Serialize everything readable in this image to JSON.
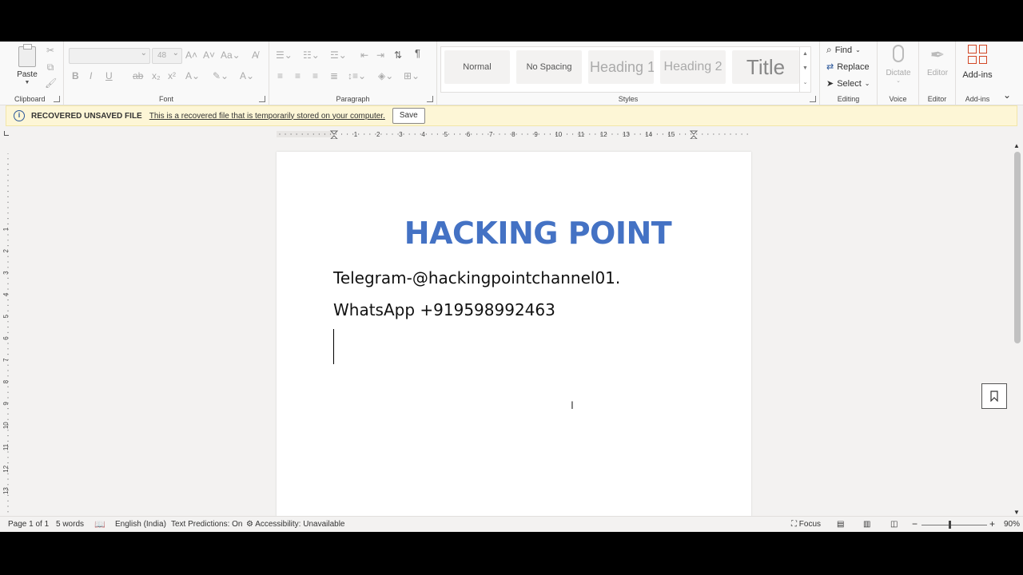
{
  "ribbon": {
    "clipboard": {
      "paste_label": "Paste",
      "group_label": "Clipboard"
    },
    "font": {
      "font_name": "",
      "font_size": "48",
      "group_label": "Font"
    },
    "paragraph": {
      "group_label": "Paragraph",
      "pilcrow": "¶"
    },
    "styles": {
      "group_label": "Styles",
      "items": [
        "Normal",
        "No Spacing",
        "Heading 1",
        "Heading 2",
        "Title"
      ]
    },
    "editing": {
      "find": "Find",
      "replace": "Replace",
      "select": "Select",
      "group_label": "Editing"
    },
    "voice": {
      "dictate": "Dictate",
      "group_label": "Voice"
    },
    "editor": {
      "label": "Editor",
      "group_label": "Editor"
    },
    "addins": {
      "label": "Add-ins",
      "group_label": "Add-ins"
    }
  },
  "infobar": {
    "title": "RECOVERED UNSAVED FILE",
    "message": "This is a recovered file that is temporarily stored on your computer.",
    "button": "Save"
  },
  "document": {
    "heading": "HACKING POINT",
    "line1": "Telegram-@hackingpointchannel01.",
    "line2": "WhatsApp +919598992463"
  },
  "ruler": {
    "h_numbers": [
      "1",
      "2",
      "3",
      "4",
      "5",
      "6",
      "7",
      "8",
      "9",
      "10",
      "11",
      "12",
      "13",
      "14",
      "15"
    ],
    "v_numbers": [
      "1",
      "2",
      "3",
      "4",
      "5",
      "6",
      "7",
      "8",
      "9",
      "10",
      "11",
      "12",
      "13"
    ]
  },
  "statusbar": {
    "page": "Page 1 of 1",
    "words": "5 words",
    "language": "English (India)",
    "predictions": "Text Predictions: On",
    "accessibility": "Accessibility: Unavailable",
    "focus": "Focus",
    "zoom": "90%"
  },
  "colors": {
    "heading": "#4472c4",
    "infobar_bg": "#fdf6d6",
    "accent": "#2b579a"
  }
}
